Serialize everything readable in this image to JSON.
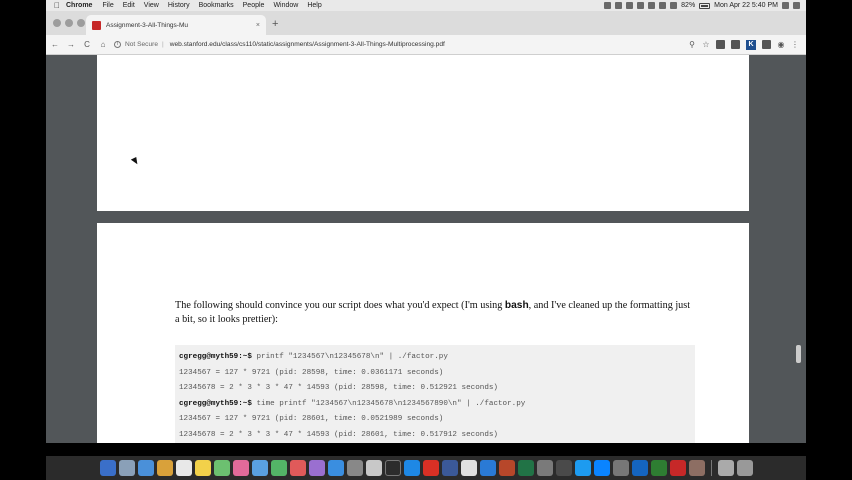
{
  "menubar": {
    "app": "Chrome",
    "items": [
      "File",
      "Edit",
      "View",
      "History",
      "Bookmarks",
      "People",
      "Window",
      "Help"
    ],
    "battery": "82%",
    "clock": "Mon Apr 22  5:40 PM"
  },
  "tab": {
    "title": "Assignment-3-All-Things-Mu",
    "close": "×"
  },
  "toolbar": {
    "back": "←",
    "forward": "→",
    "reload": "C",
    "home": "⌂",
    "security": "Not Secure",
    "url": "web.stanford.edu/class/cs110/static/assignments/Assignment-3-All-Things-Multiprocessing.pdf",
    "extension_k": "K"
  },
  "pdf": {
    "paragraph_pre": "The following should convince you our script does what you'd expect (I'm using ",
    "paragraph_bold": "bash",
    "paragraph_post": ", and I've cleaned up the formatting just a bit, so it looks prettier):",
    "terminal": [
      {
        "prompt": "cgregg@myth59:~$",
        "text": " printf \"1234567\\n12345678\\n\" | ./factor.py"
      },
      {
        "prompt": "",
        "text": "1234567 = 127 * 9721 (pid: 28598, time: 0.0361171 seconds)"
      },
      {
        "prompt": "",
        "text": "12345678 = 2 * 3 * 3 * 47 * 14593 (pid: 28598, time: 0.512921 seconds)"
      },
      {
        "prompt": "cgregg@myth59:~$",
        "text": " time printf \"1234567\\n12345678\\n1234567890\\n\" | ./factor.py"
      },
      {
        "prompt": "",
        "text": "1234567 = 127 * 9721 (pid: 28601, time: 0.0521989 seconds)"
      },
      {
        "prompt": "",
        "text": "12345678 = 2 * 3 * 3 * 47 * 14593 (pid: 28601, time: 0.517912 seconds)"
      }
    ]
  }
}
